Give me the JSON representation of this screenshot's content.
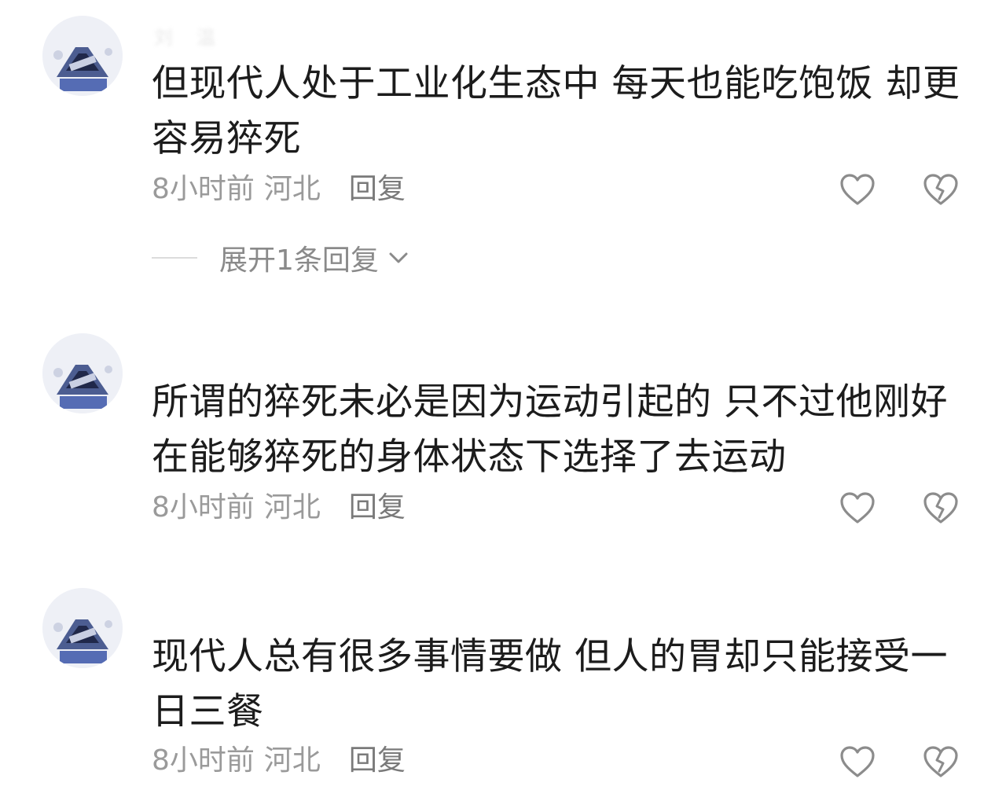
{
  "comments": [
    {
      "username": "刘__温",
      "text": "但现代人处于工业化生态中  每天也能吃饱饭 却更容易猝死",
      "time": "8小时前",
      "location": "河北",
      "reply_label": "回复",
      "expand_label": "展开1条回复",
      "like_icon": "heart-outline-icon",
      "dislike_icon": "broken-heart-icon"
    },
    {
      "username": "",
      "text": "所谓的猝死未必是因为运动引起的  只不过他刚好在能够猝死的身体状态下选择了去运动",
      "time": "8小时前",
      "location": "河北",
      "reply_label": "回复",
      "like_icon": "heart-outline-icon",
      "dislike_icon": "broken-heart-icon"
    },
    {
      "username": "",
      "text": "现代人总有很多事情要做  但人的胃却只能接受一日三餐",
      "time": "8小时前",
      "location": "河北",
      "reply_label": "回复",
      "like_icon": "heart-outline-icon",
      "dislike_icon": "broken-heart-icon"
    }
  ],
  "colors": {
    "text": "#1c1c1c",
    "meta": "#9a9a9a",
    "reply": "#7a7a7a",
    "icon": "#8c8c8c",
    "background": "#ffffff"
  }
}
